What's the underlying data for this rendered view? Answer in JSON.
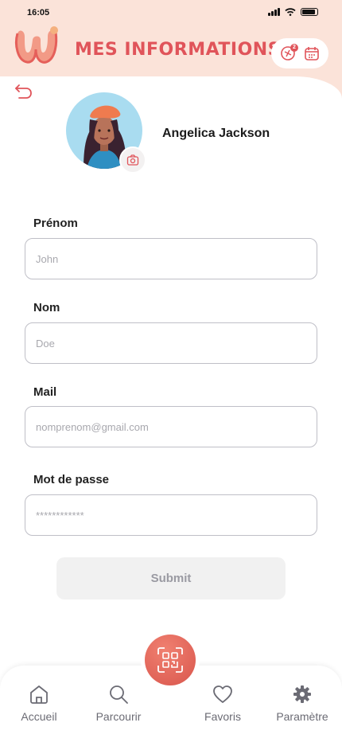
{
  "status": {
    "time": "16:05"
  },
  "header": {
    "title": "MES iNFORMATIONS",
    "notification_count": "2"
  },
  "profile": {
    "name": "Angelica Jackson"
  },
  "form": {
    "firstname": {
      "label": "Prénom",
      "placeholder": "John"
    },
    "lastname": {
      "label": "Nom",
      "placeholder": "Doe"
    },
    "mail": {
      "label": "Mail",
      "placeholder": "nomprenom@gmail.com"
    },
    "password": {
      "label": "Mot de passe",
      "placeholder": "************"
    },
    "submit_label": "Submit"
  },
  "nav": {
    "items": [
      {
        "label": "Accueil",
        "icon": "home-icon"
      },
      {
        "label": "Parcourir",
        "icon": "search-icon"
      },
      {
        "label": "Favoris",
        "icon": "heart-icon"
      },
      {
        "label": "Paramètre",
        "icon": "gear-icon"
      }
    ],
    "center_icon": "qr-scan-icon"
  },
  "colors": {
    "accent": "#e0545a",
    "header_bg": "#fbe3d9",
    "avatar_bg": "#a9dcf0"
  }
}
